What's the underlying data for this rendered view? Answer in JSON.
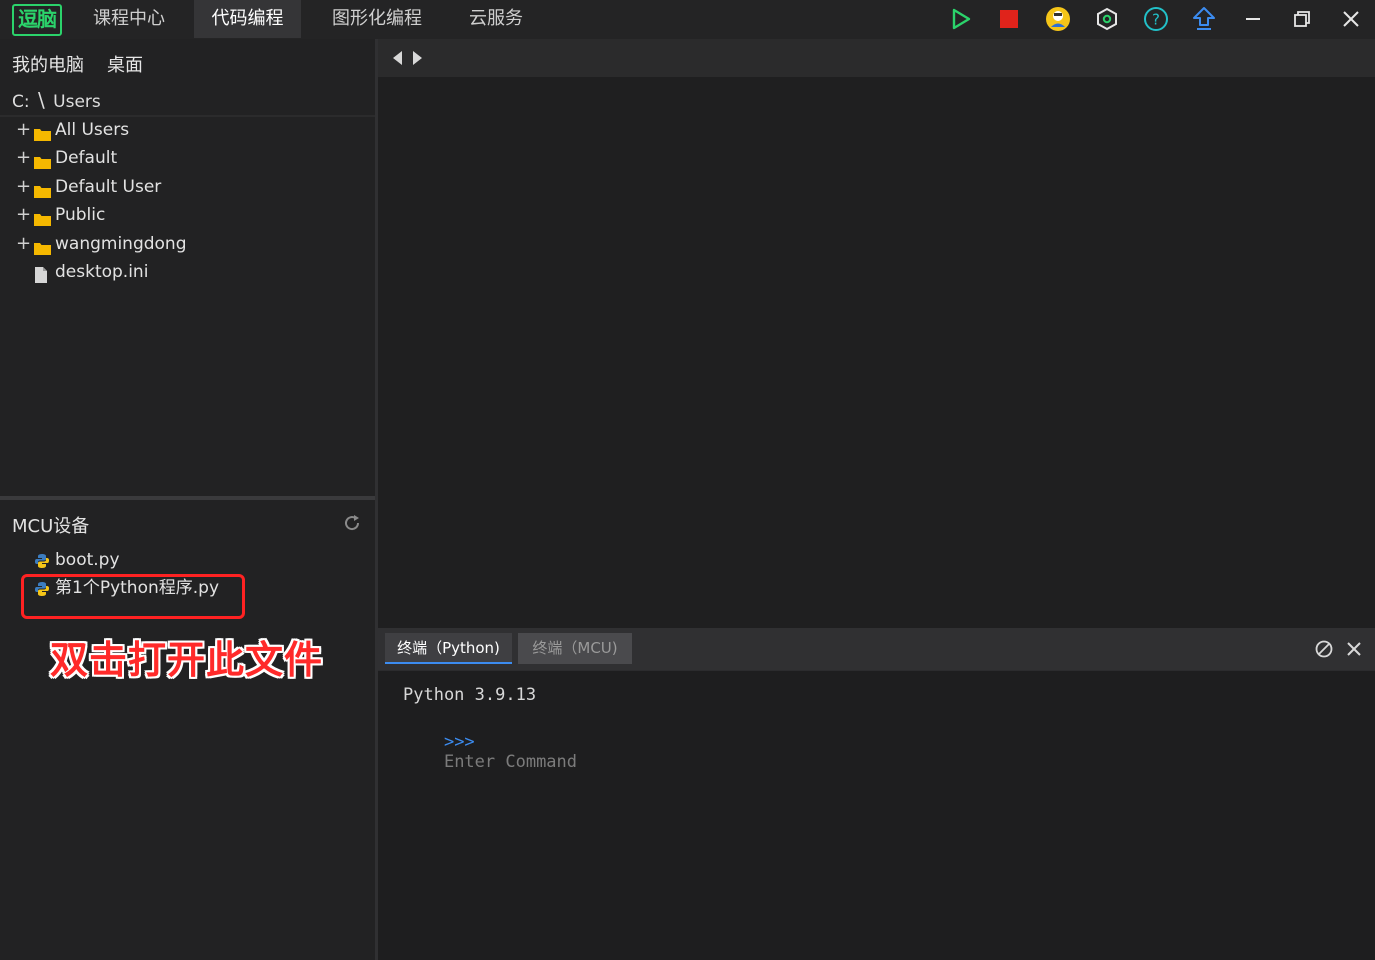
{
  "app": {
    "logo_text": "逗脑",
    "nav_tabs": [
      {
        "label": "课程中心",
        "active": false
      },
      {
        "label": "代码编程",
        "active": true
      },
      {
        "label": "图形化编程",
        "active": false
      },
      {
        "label": "云服务",
        "active": false
      }
    ],
    "toolbar_icons": [
      "run-icon",
      "stop-icon",
      "user-avatar-icon",
      "settings-hex-icon",
      "help-icon",
      "upload-icon",
      "minimize-icon",
      "restore-icon",
      "close-icon"
    ],
    "colors": {
      "accent_green": "#2bd36b",
      "stop_red": "#e0231b",
      "accent_blue": "#3c8cf0",
      "annotation_red": "#ff2a2a"
    }
  },
  "file_browser": {
    "location_tabs": [
      "我的电脑",
      "桌面"
    ],
    "path": {
      "drive": "C:",
      "separator": "\\",
      "folder": "Users"
    },
    "items": [
      {
        "label": "All Users",
        "type": "folder"
      },
      {
        "label": "Default",
        "type": "folder"
      },
      {
        "label": "Default User",
        "type": "folder"
      },
      {
        "label": "Public",
        "type": "folder"
      },
      {
        "label": "wangmingdong",
        "type": "folder"
      },
      {
        "label": "desktop.ini",
        "type": "file"
      }
    ]
  },
  "mcu": {
    "title": "MCU设备",
    "files": [
      {
        "label": "boot.py"
      },
      {
        "label": "第1个Python程序.py"
      }
    ],
    "annotation": "双击打开此文件"
  },
  "terminal": {
    "tabs": [
      {
        "label": "终端（Python)",
        "active": true
      },
      {
        "label": "终端（MCU)",
        "active": false
      }
    ],
    "version_line": "Python 3.9.13",
    "prompt": ">>>",
    "placeholder": "Enter Command"
  }
}
